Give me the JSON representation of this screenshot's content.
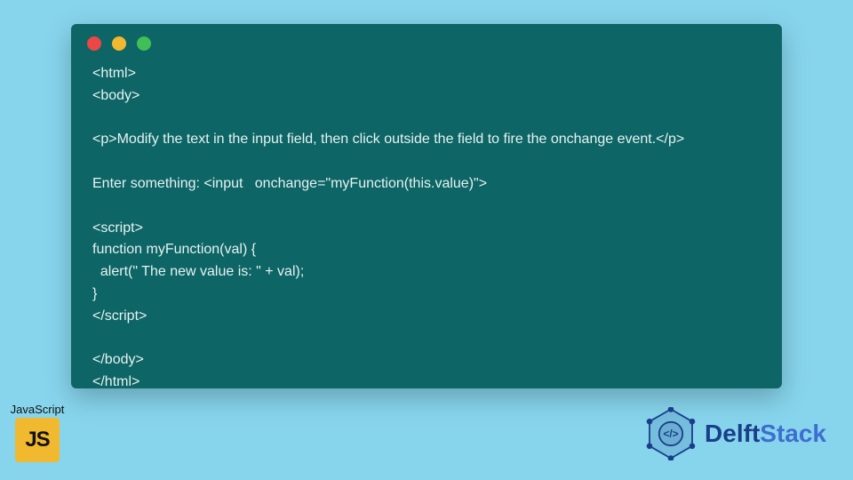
{
  "code_window": {
    "dots": [
      "red",
      "yellow",
      "green"
    ],
    "code": "<html>\n<body>\n\n<p>Modify the text in the input field, then click outside the field to fire the onchange event.</p>\n\nEnter something: <input   onchange=\"myFunction(this.value)\">\n\n<script>\nfunction myFunction(val) {\n  alert(\" The new value is: \" + val);\n}\n</script>\n\n</body>\n</html>"
  },
  "js_badge": {
    "label": "JavaScript",
    "tile_text": "JS"
  },
  "brand": {
    "name_first": "Delft",
    "name_second": "Stack"
  }
}
